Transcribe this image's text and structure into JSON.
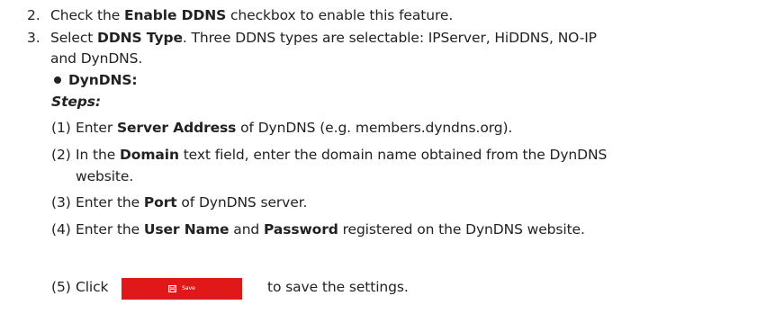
{
  "list": {
    "item2": {
      "number": "2.",
      "t1": "Check the ",
      "b1": "Enable DDNS",
      "t2": " checkbox to enable this feature."
    },
    "item3": {
      "number": "3.",
      "t1": "Select ",
      "b1": "DDNS Type",
      "t2": ". Three DDNS types are selectable: IPServer, HiDDNS, NO-IP",
      "t3": "and DynDNS."
    }
  },
  "bullet": {
    "label": "DynDNS:"
  },
  "steps_heading": "Steps:",
  "steps": [
    {
      "number": "(1)",
      "t1": "Enter ",
      "b1": "Server Address",
      "t2": " of DynDNS (e.g. members.dyndns.org)."
    },
    {
      "number": "(2)",
      "t1": "In the ",
      "b1": "Domain",
      "t2": " text field, enter the domain name obtained from the DynDNS",
      "t3": "website."
    },
    {
      "number": "(3)",
      "t1": "Enter the ",
      "b1": "Port",
      "t2": " of DynDNS server."
    },
    {
      "number": "(4)",
      "t1": "Enter the ",
      "b1": "User Name",
      "t2": " and ",
      "b2": "Password",
      "t3": " registered on the DynDNS website."
    },
    {
      "number": "(5)",
      "t1": "Click",
      "t2": "to save the settings."
    }
  ],
  "save_button": {
    "label": "Save",
    "icon": "floppy-disk-icon",
    "color": "#e11818"
  }
}
